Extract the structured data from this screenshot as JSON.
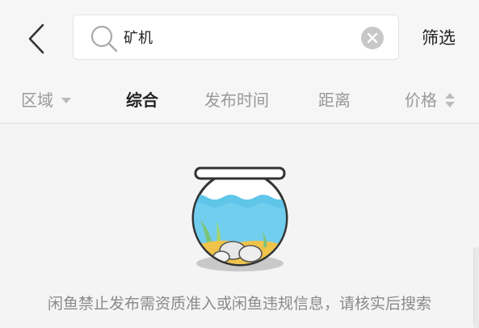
{
  "search": {
    "query": "矿机"
  },
  "header": {
    "filter_label": "筛选"
  },
  "sort_bar": {
    "region_label": "区域",
    "tabs": [
      {
        "label": "综合"
      },
      {
        "label": "发布时间"
      },
      {
        "label": "距离"
      }
    ],
    "price_label": "价格"
  },
  "empty_state": {
    "notice": "闲鱼禁止发布需资质准入或闲鱼违规信息，请核实后搜索"
  },
  "icons": {
    "back": "chevron-left-icon",
    "search": "search-icon",
    "clear": "clear-icon",
    "region_dropdown": "caret-down-icon",
    "price_sort": "sort-icon",
    "illustration": "fishbowl-icon"
  },
  "colors": {
    "background": "#f4f4f4",
    "water": "#5fc6ea",
    "plant": "#7cc47a",
    "sand": "#f0c34a"
  }
}
